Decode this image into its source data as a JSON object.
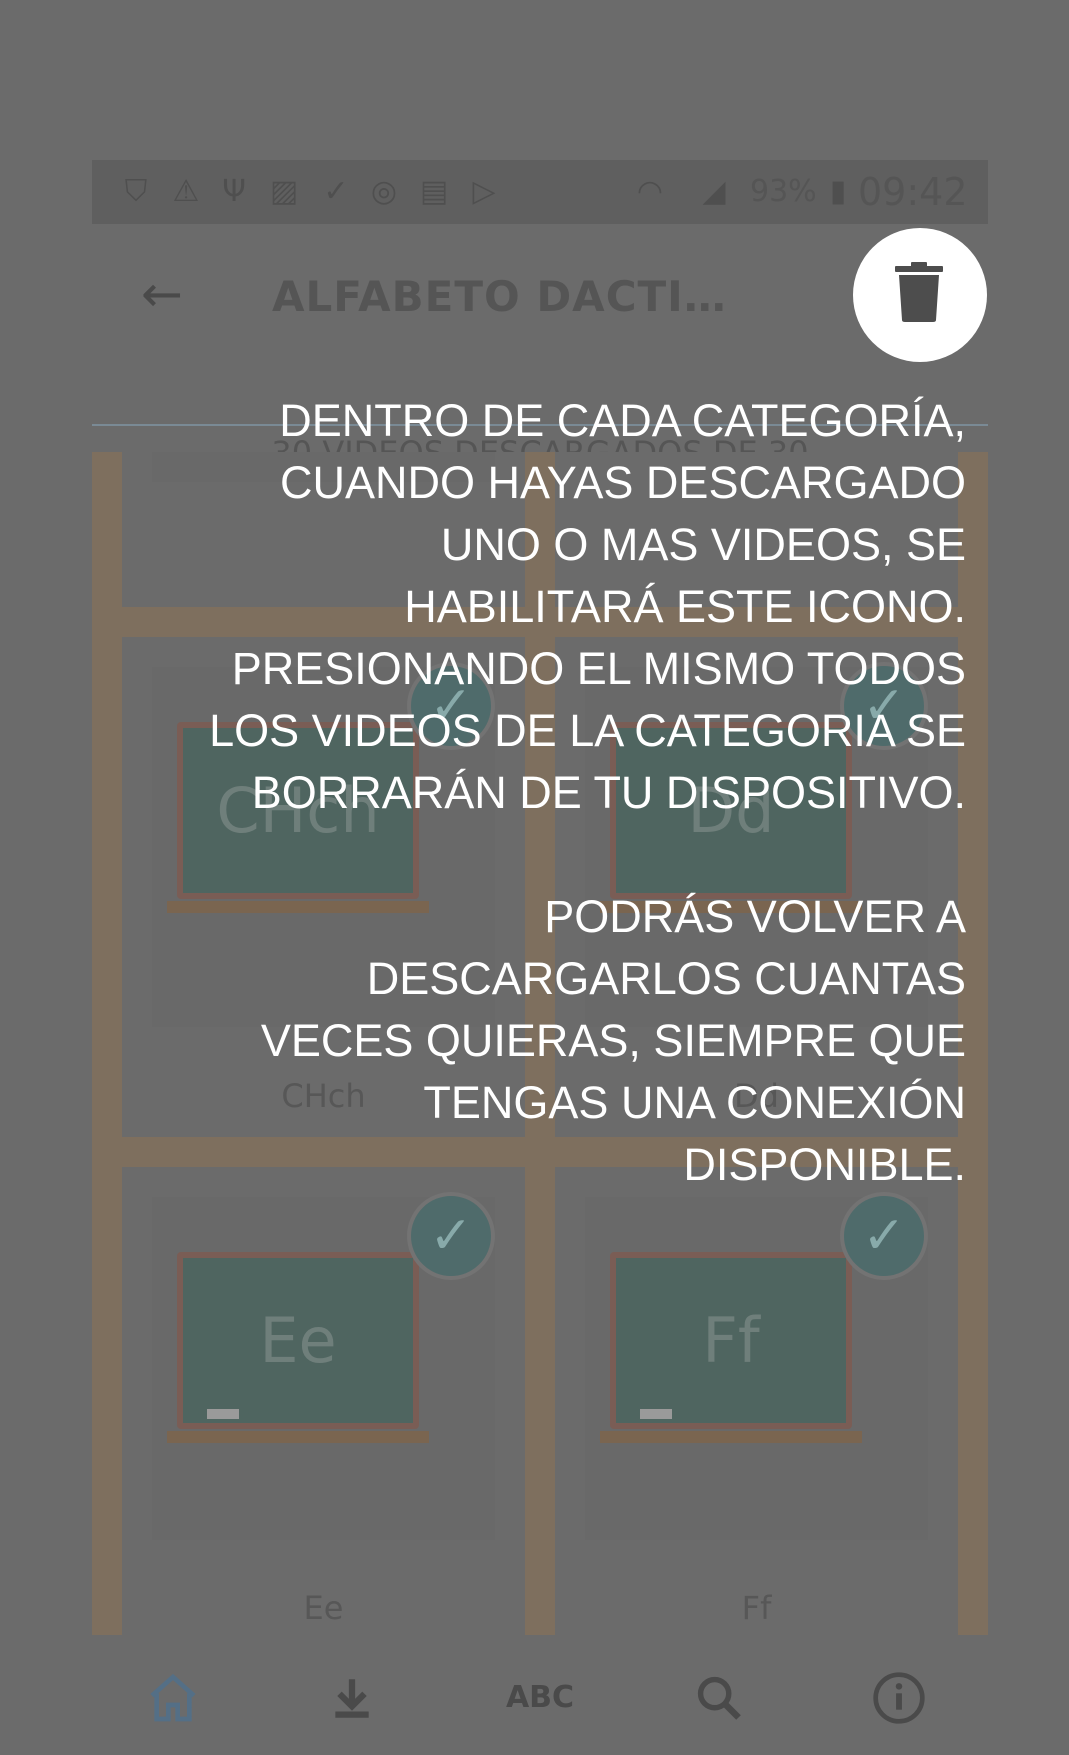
{
  "status_bar": {
    "battery": "93%",
    "time": "09:42",
    "icons": [
      "shield-play-icon",
      "warning-icon",
      "usb-icon",
      "image-icon",
      "download-done-icon",
      "sync-icon",
      "sim-icon",
      "play-store-icon",
      "wifi-icon",
      "signal-icon",
      "battery-charging-icon"
    ]
  },
  "app_bar": {
    "title": "ALFABETO DACTILOLÓ...",
    "back_icon": "arrow-back-icon",
    "delete_icon": "trash-icon"
  },
  "subtitle": "30 VIDEOS DESCARGADOS DE 30",
  "tiles": [
    {
      "board": "CHch",
      "label": "CHch"
    },
    {
      "board": "Dd",
      "label": "Dd"
    },
    {
      "board": "Ee",
      "label": "Ee"
    },
    {
      "board": "Ff",
      "label": "Ff"
    }
  ],
  "bottom_nav": {
    "items": [
      {
        "name": "home-icon",
        "label": "⌂"
      },
      {
        "name": "download-icon",
        "label": "⤓"
      },
      {
        "name": "abc",
        "label": "ABC"
      },
      {
        "name": "search-icon",
        "label": "⌕"
      },
      {
        "name": "info-icon",
        "label": "ⓘ"
      }
    ]
  },
  "tutorial": {
    "paragraph1": "DENTRO DE CADA CATEGORÍA, CUANDO HAYAS DESCARGADO UNO O MAS VIDEOS, SE HABILITARÁ ESTE ICONO. PRESIONANDO EL MISMO TODOS LOS VIDEOS DE LA CATEGORIA SE BORRARÁN DE TU DISPOSITIVO.",
    "paragraph2": "PODRÁS VOLVER A DESCARGARLOS CUANTAS VECES QUIERAS, SIEMPRE QUE TENGAS UNA CONEXIÓN DISPONIBLE."
  },
  "colors": {
    "scrim": "#6b6b6b",
    "grid_frame": "#7e6f5e",
    "board": "#4f6560",
    "check": "#4f6b6b",
    "text": "#ffffff"
  }
}
